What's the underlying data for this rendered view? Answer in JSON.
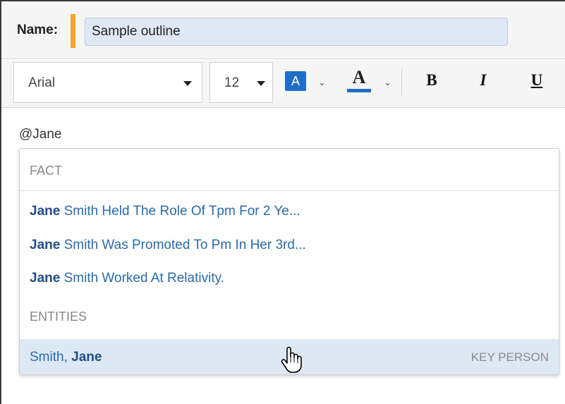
{
  "name_field": {
    "label": "Name:",
    "value": "Sample outline",
    "accent_color": "#f5a623"
  },
  "toolbar": {
    "font_family": "Arial",
    "font_size": "12",
    "highlight_label": "A",
    "highlight_color": "#1e6ec8",
    "font_color_label": "A",
    "bold_label": "B",
    "italic_label": "I",
    "underline_label": "U"
  },
  "editor": {
    "text": "@Jane"
  },
  "mention_dropdown": {
    "fact_header": "FACT",
    "facts": [
      {
        "match": "Jane",
        "rest": " Smith Held The Role Of Tpm For 2 Ye..."
      },
      {
        "match": "Jane",
        "rest": " Smith Was Promoted To Pm In Her 3rd..."
      },
      {
        "match": "Jane",
        "rest": " Smith Worked At Relativity."
      }
    ],
    "entities_header": "ENTITIES",
    "entities": [
      {
        "prefix": "Smith, ",
        "match": "Jane",
        "type": "KEY PERSON"
      }
    ],
    "selected_bg": "#dde8f5",
    "link_color": "#2b6aa9"
  }
}
